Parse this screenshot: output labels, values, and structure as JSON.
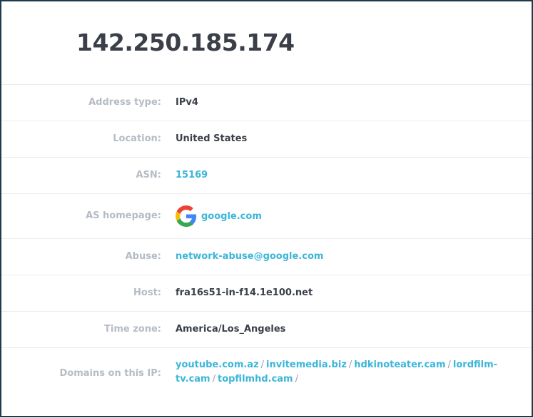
{
  "ip": "142.250.185.174",
  "rows": {
    "address_type": {
      "label": "Address type:",
      "value": "IPv4"
    },
    "location": {
      "label": "Location:",
      "value": "United States"
    },
    "asn": {
      "label": "ASN:",
      "value": "15169"
    },
    "as_homepage": {
      "label": "AS homepage:",
      "value": "google.com",
      "icon": "google-g-logo-icon"
    },
    "abuse": {
      "label": "Abuse:",
      "value": "network-abuse@google.com"
    },
    "host": {
      "label": "Host:",
      "value": "fra16s51-in-f14.1e100.net"
    },
    "time_zone": {
      "label": "Time zone:",
      "value": "America/Los_Angeles"
    },
    "domains": {
      "label": "Domains on this IP:",
      "items": [
        "youtube.com.az",
        "invitemedia.biz",
        "hdkinoteater.cam",
        "lordfilm-tv.cam",
        "topfilmhd.cam"
      ],
      "separator": "/"
    }
  },
  "colors": {
    "title": "#3a3f48",
    "label": "#b5bcc4",
    "value": "#3a3f48",
    "link": "#3bb6d9",
    "border": "#1f3a4a"
  }
}
